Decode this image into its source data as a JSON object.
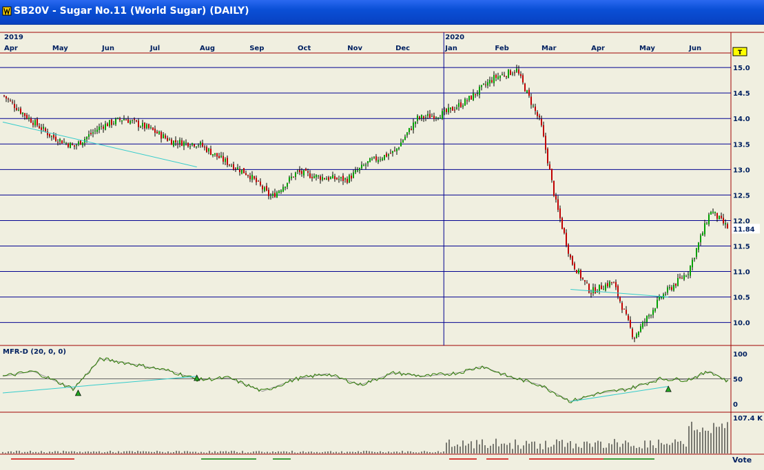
{
  "window": {
    "title": "SB20V - Sugar No.11 (World Sugar) (DAILY)"
  },
  "chart_data": [
    {
      "type": "candlestick",
      "title": "",
      "time_axis": {
        "years": [
          "2019",
          "2020"
        ],
        "months": [
          "Apr",
          "May",
          "Jun",
          "Jul",
          "Aug",
          "Sep",
          "Oct",
          "Nov",
          "Dec",
          "Jan",
          "Feb",
          "Mar",
          "Apr",
          "May",
          "Jun"
        ]
      },
      "y_ticks": [
        "15.0",
        "14.5",
        "14.0",
        "13.5",
        "13.0",
        "12.5",
        "12.0",
        "11.5",
        "11.0",
        "10.5",
        "10.0"
      ],
      "ylim": [
        9.55,
        15.15
      ],
      "last_price": "11.84",
      "marker_label": "T",
      "colors": {
        "up": "#00a000",
        "down": "#c00000",
        "trendline": "#33cccc",
        "gridline": "#000090",
        "panel_border": "#a00000"
      },
      "close_series": {
        "x": [
          "2019-04-01",
          "2019-04-15",
          "2019-05-01",
          "2019-05-15",
          "2019-06-01",
          "2019-06-15",
          "2019-07-01",
          "2019-07-15",
          "2019-08-01",
          "2019-08-15",
          "2019-09-01",
          "2019-09-15",
          "2019-10-01",
          "2019-10-15",
          "2019-11-01",
          "2019-11-15",
          "2019-12-01",
          "2019-12-15",
          "2020-01-01",
          "2020-01-15",
          "2020-02-01",
          "2020-02-15",
          "2020-03-01",
          "2020-03-10",
          "2020-03-20",
          "2020-04-01",
          "2020-04-15",
          "2020-04-28",
          "2020-05-15",
          "2020-06-01",
          "2020-06-15",
          "2020-06-26"
        ],
        "close": [
          14.45,
          14.05,
          13.65,
          13.45,
          13.85,
          14.0,
          13.8,
          13.55,
          13.5,
          13.2,
          12.9,
          12.45,
          12.95,
          12.85,
          12.8,
          13.15,
          13.35,
          14.0,
          14.1,
          14.35,
          14.8,
          14.95,
          13.9,
          12.4,
          11.2,
          10.6,
          10.8,
          9.7,
          10.5,
          11.0,
          12.2,
          11.84
        ]
      },
      "trendlines": [
        {
          "from": [
            "2019-04-01",
            13.93
          ],
          "to": [
            "2019-07-31",
            13.05
          ]
        },
        {
          "from": [
            "2020-03-20",
            10.65
          ],
          "to": [
            "2020-05-20",
            10.5
          ]
        }
      ]
    },
    {
      "type": "line",
      "title": "MFR-D (20, 0, 0)",
      "y_ticks": [
        "100",
        "50",
        "0"
      ],
      "ylim": [
        0,
        100
      ],
      "x": [
        "2019-04-01",
        "2019-04-20",
        "2019-05-15",
        "2019-06-01",
        "2019-06-20",
        "2019-07-15",
        "2019-08-01",
        "2019-08-20",
        "2019-09-10",
        "2019-10-01",
        "2019-10-20",
        "2019-11-10",
        "2019-12-01",
        "2019-12-20",
        "2020-01-10",
        "2020-01-25",
        "2020-02-10",
        "2020-03-01",
        "2020-03-20",
        "2020-04-05",
        "2020-04-25",
        "2020-05-15",
        "2020-06-01",
        "2020-06-15",
        "2020-06-26"
      ],
      "values": [
        55,
        65,
        30,
        90,
        80,
        65,
        48,
        52,
        25,
        50,
        60,
        38,
        62,
        55,
        62,
        75,
        55,
        38,
        5,
        20,
        30,
        50,
        48,
        65,
        45
      ],
      "trendlines": [
        {
          "from": [
            "2019-04-01",
            22
          ],
          "to": [
            "2019-07-31",
            55
          ]
        },
        {
          "from": [
            "2020-03-20",
            5
          ],
          "to": [
            "2020-05-20",
            35
          ]
        }
      ]
    },
    {
      "type": "bar",
      "title": "",
      "label": "107.4 K",
      "values": []
    }
  ],
  "footer": {
    "vote_label": "Vote"
  }
}
